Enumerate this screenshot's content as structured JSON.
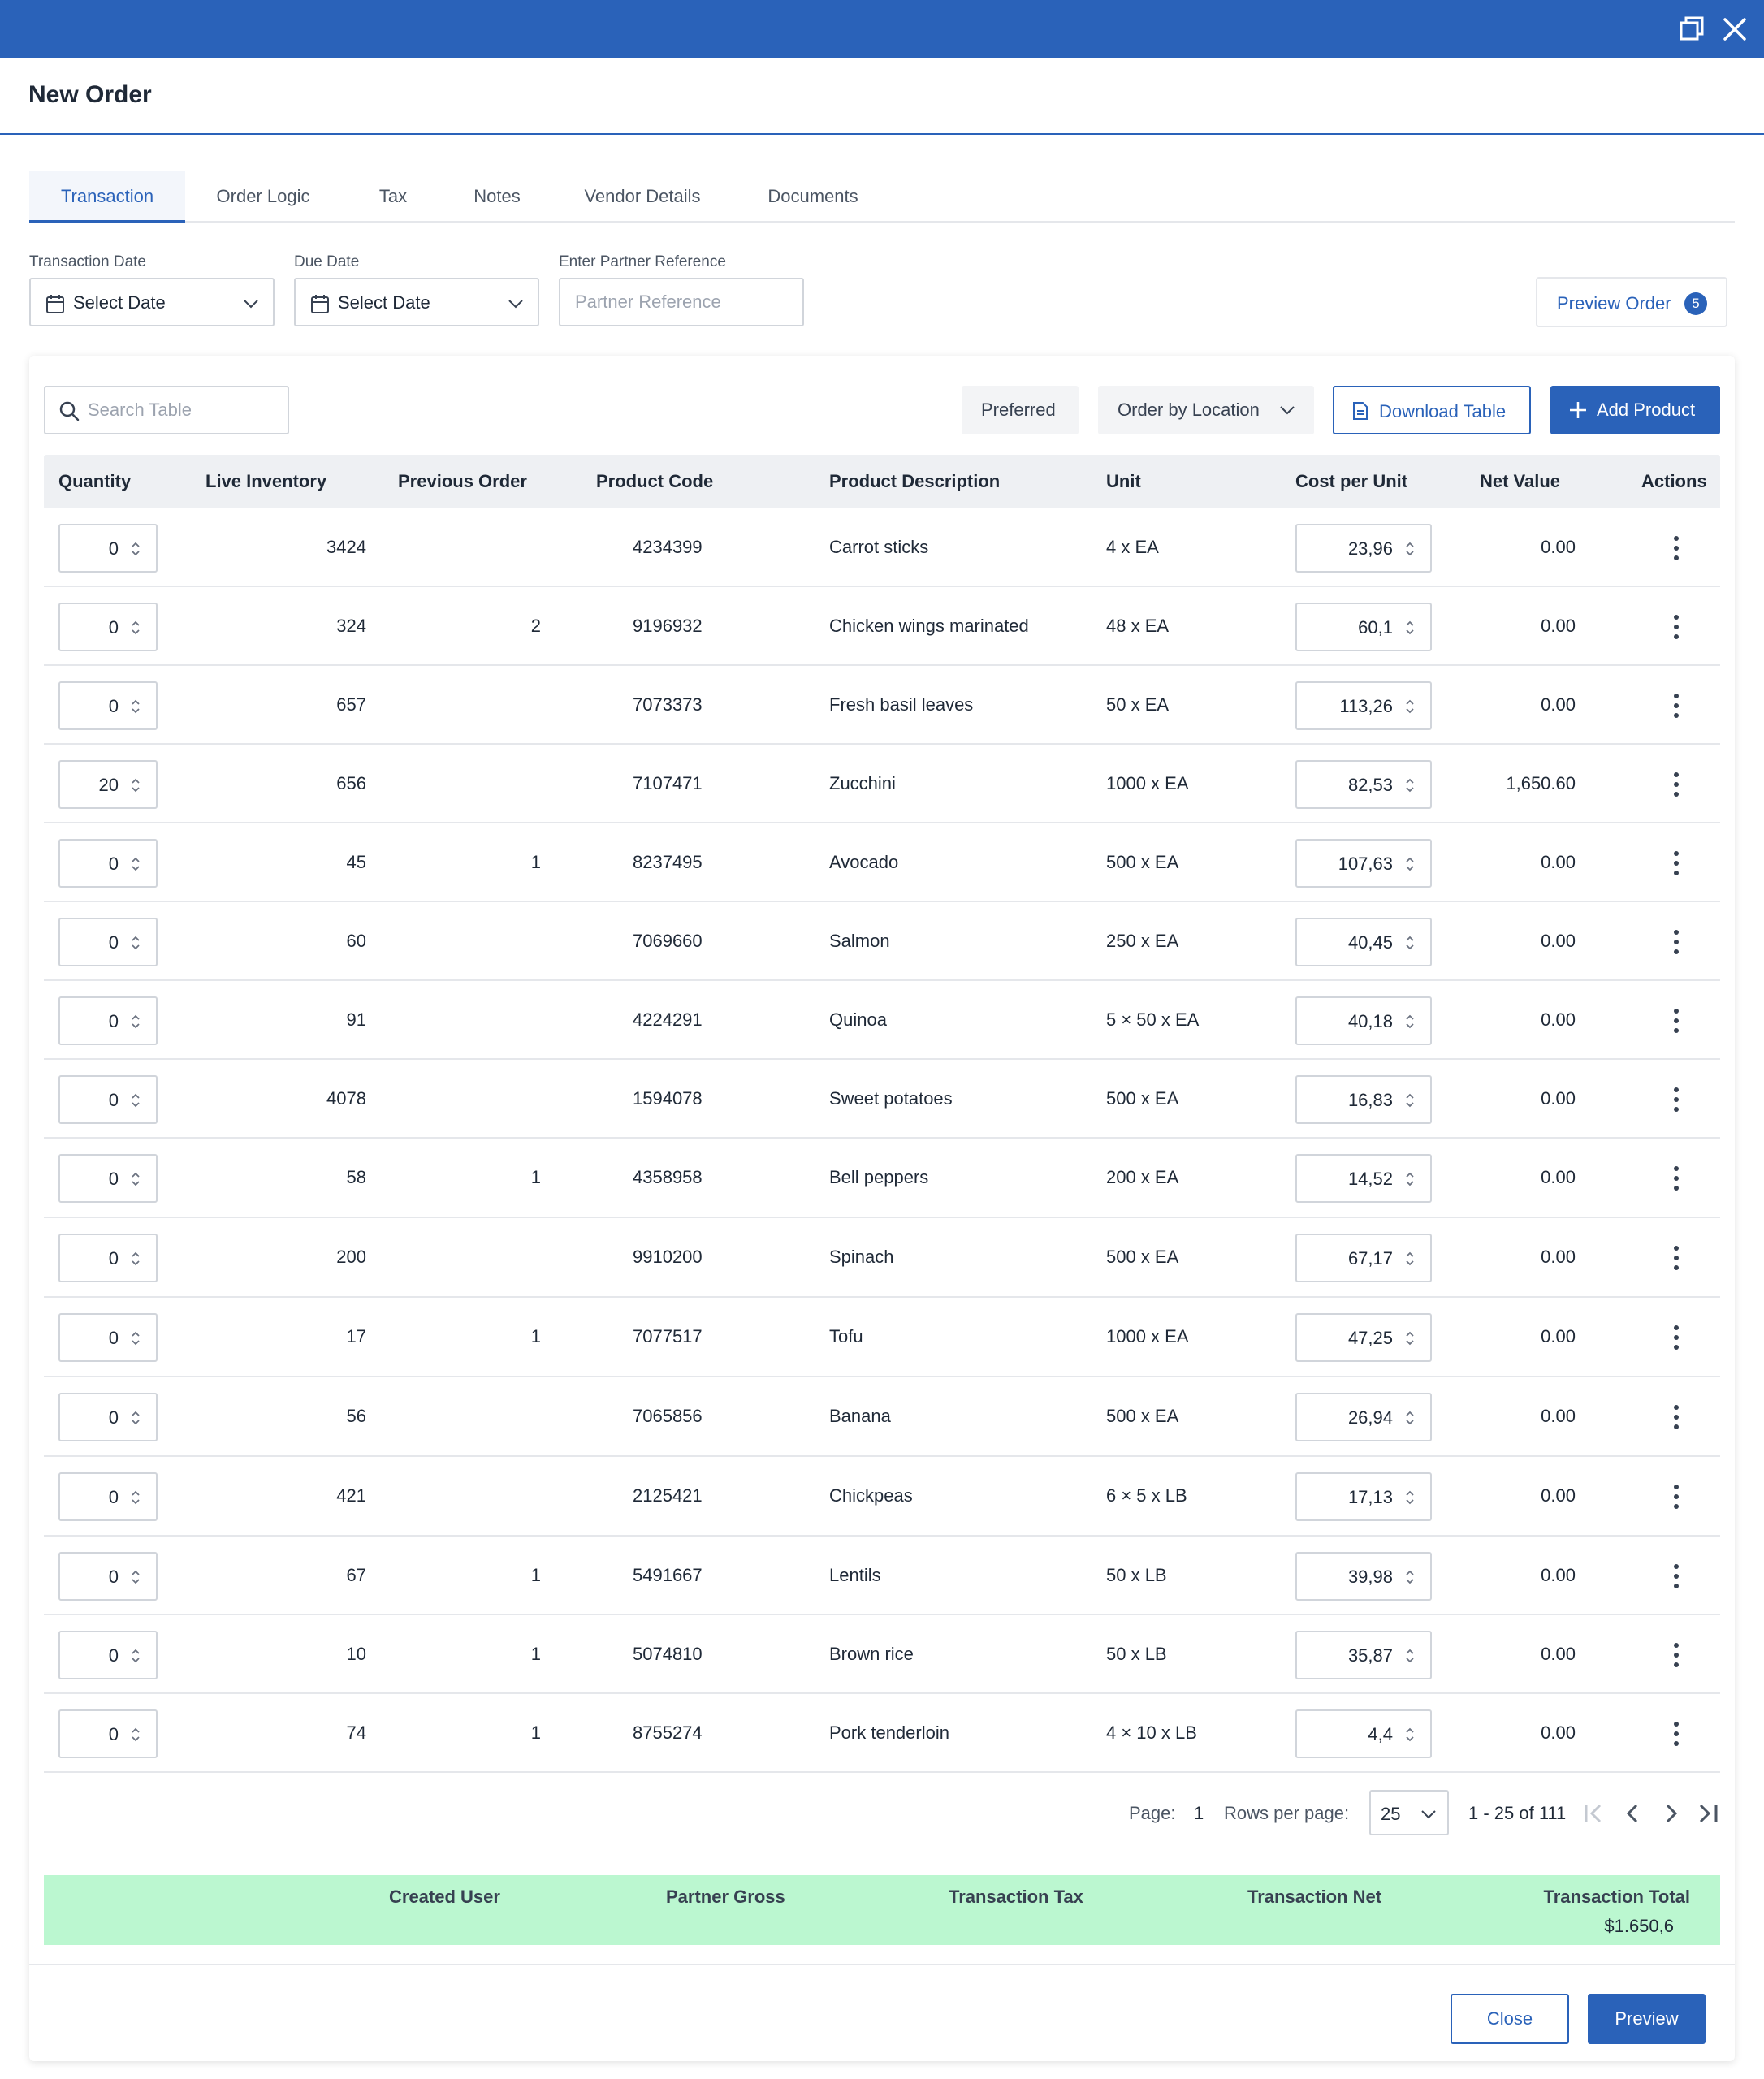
{
  "window": {
    "title": "New Order",
    "icons": {
      "restore": "restore-window-icon",
      "close": "close-icon"
    },
    "titlebar_color": "#2a62b9"
  },
  "tabs": [
    {
      "label": "Transaction",
      "active": true
    },
    {
      "label": "Order Logic",
      "active": false
    },
    {
      "label": "Tax",
      "active": false
    },
    {
      "label": "Notes",
      "active": false
    },
    {
      "label": "Vendor Details",
      "active": false
    },
    {
      "label": "Documents",
      "active": false
    }
  ],
  "form": {
    "transaction_date": {
      "label": "Transaction Date",
      "value": "Select Date"
    },
    "due_date": {
      "label": "Due Date",
      "value": "Select Date"
    },
    "partner_reference": {
      "label": "Enter Partner Reference",
      "placeholder": "Partner Reference",
      "value": ""
    }
  },
  "preview_order": {
    "label": "Preview Order",
    "count": "5"
  },
  "toolbar": {
    "search_placeholder": "Search Table",
    "preferred": "Preferred",
    "order_by_location": "Order by Location",
    "download_table": "Download Table",
    "add_product": "Add Product"
  },
  "table": {
    "columns": [
      "Quantity",
      "Live Inventory",
      "Previous Order",
      "Product Code",
      "Product Description",
      "Unit",
      "Cost per Unit",
      "Net Value",
      "Actions"
    ],
    "rows": [
      {
        "qty": "0",
        "inventory": "3424",
        "prev": "",
        "code": "4234399",
        "desc": "Carrot sticks",
        "unit": "4 x EA",
        "cost": "23,96",
        "net": "0.00"
      },
      {
        "qty": "0",
        "inventory": "324",
        "prev": "2",
        "code": "9196932",
        "desc": "Chicken wings marinated",
        "unit": "48 x EA",
        "cost": "60,1",
        "net": "0.00"
      },
      {
        "qty": "0",
        "inventory": "657",
        "prev": "",
        "code": "7073373",
        "desc": "Fresh basil leaves",
        "unit": "50 x EA",
        "cost": "113,26",
        "net": "0.00"
      },
      {
        "qty": "20",
        "inventory": "656",
        "prev": "",
        "code": "7107471",
        "desc": "Zucchini",
        "unit": "1000 x EA",
        "cost": "82,53",
        "net": "1,650.60"
      },
      {
        "qty": "0",
        "inventory": "45",
        "prev": "1",
        "code": "8237495",
        "desc": "Avocado",
        "unit": "500 x EA",
        "cost": "107,63",
        "net": "0.00"
      },
      {
        "qty": "0",
        "inventory": "60",
        "prev": "",
        "code": "7069660",
        "desc": "Salmon",
        "unit": "250 x EA",
        "cost": "40,45",
        "net": "0.00"
      },
      {
        "qty": "0",
        "inventory": "91",
        "prev": "",
        "code": "4224291",
        "desc": "Quinoa",
        "unit": "5 × 50 x EA",
        "cost": "40,18",
        "net": "0.00"
      },
      {
        "qty": "0",
        "inventory": "4078",
        "prev": "",
        "code": "1594078",
        "desc": "Sweet potatoes",
        "unit": "500 x EA",
        "cost": "16,83",
        "net": "0.00"
      },
      {
        "qty": "0",
        "inventory": "58",
        "prev": "1",
        "code": "4358958",
        "desc": "Bell peppers",
        "unit": "200 x EA",
        "cost": "14,52",
        "net": "0.00"
      },
      {
        "qty": "0",
        "inventory": "200",
        "prev": "",
        "code": "9910200",
        "desc": "Spinach",
        "unit": "500 x EA",
        "cost": "67,17",
        "net": "0.00"
      },
      {
        "qty": "0",
        "inventory": "17",
        "prev": "1",
        "code": "7077517",
        "desc": "Tofu",
        "unit": "1000 x EA",
        "cost": "47,25",
        "net": "0.00"
      },
      {
        "qty": "0",
        "inventory": "56",
        "prev": "",
        "code": "7065856",
        "desc": "Banana",
        "unit": "500 x EA",
        "cost": "26,94",
        "net": "0.00"
      },
      {
        "qty": "0",
        "inventory": "421",
        "prev": "",
        "code": "2125421",
        "desc": "Chickpeas",
        "unit": "6 × 5 x LB",
        "cost": "17,13",
        "net": "0.00"
      },
      {
        "qty": "0",
        "inventory": "67",
        "prev": "1",
        "code": "5491667",
        "desc": "Lentils",
        "unit": "50 x LB",
        "cost": "39,98",
        "net": "0.00"
      },
      {
        "qty": "0",
        "inventory": "10",
        "prev": "1",
        "code": "5074810",
        "desc": "Brown rice",
        "unit": "50 x LB",
        "cost": "35,87",
        "net": "0.00"
      },
      {
        "qty": "0",
        "inventory": "74",
        "prev": "1",
        "code": "8755274",
        "desc": "Pork tenderloin",
        "unit": "4 × 10 x LB",
        "cost": "4,4",
        "net": "0.00"
      }
    ]
  },
  "pagination": {
    "page_label": "Page:",
    "page": "1",
    "rows_label": "Rows per page:",
    "rows_per_page": "25",
    "range": "1 - 25 of 111"
  },
  "totals": {
    "labels": [
      "Created User",
      "Partner Gross",
      "Transaction Tax",
      "Transaction Net",
      "Transaction Total"
    ],
    "transaction_total": "$1.650,6",
    "color": "#bbf7d0"
  },
  "footer": {
    "close": "Close",
    "preview": "Preview"
  }
}
